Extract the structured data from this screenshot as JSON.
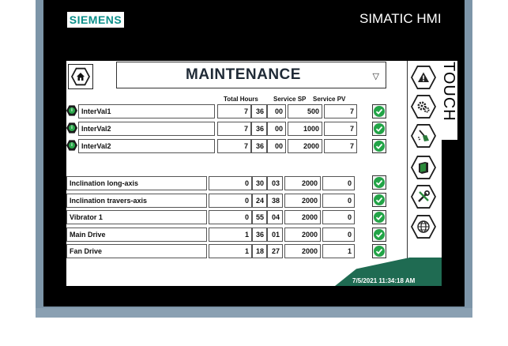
{
  "device": {
    "brand": "SIEMENS",
    "model_label": "SIMATIC HMI",
    "touch_label": "TOUCH"
  },
  "screen": {
    "title": "MAINTENANCE",
    "columns": {
      "total_hours": "Total Hours",
      "service_sp": "Service SP",
      "service_pv": "Service PV"
    },
    "intervals": [
      {
        "label": "InterVal1",
        "hours": "7",
        "minutes": "36",
        "seconds": "00",
        "service_sp": "500",
        "service_pv": "7"
      },
      {
        "label": "InterVal2",
        "hours": "7",
        "minutes": "36",
        "seconds": "00",
        "service_sp": "1000",
        "service_pv": "7"
      },
      {
        "label": "InterVal2",
        "hours": "7",
        "minutes": "36",
        "seconds": "00",
        "service_sp": "2000",
        "service_pv": "7"
      }
    ],
    "equipment": [
      {
        "label": "Inclination long-axis",
        "hours": "0",
        "minutes": "30",
        "seconds": "03",
        "service_sp": "2000",
        "service_pv": "0"
      },
      {
        "label": "Inclination travers-axis",
        "hours": "0",
        "minutes": "24",
        "seconds": "38",
        "service_sp": "2000",
        "service_pv": "0"
      },
      {
        "label": "Vibrator 1",
        "hours": "0",
        "minutes": "55",
        "seconds": "04",
        "service_sp": "2000",
        "service_pv": "0"
      },
      {
        "label": "Main Drive",
        "hours": "1",
        "minutes": "36",
        "seconds": "01",
        "service_sp": "2000",
        "service_pv": "0"
      },
      {
        "label": "Fan Drive",
        "hours": "1",
        "minutes": "18",
        "seconds": "27",
        "service_sp": "2000",
        "service_pv": "1"
      }
    ],
    "datetime": "7/5/2021 11:34:18 AM"
  },
  "nav": [
    "alarm-icon",
    "settings-gears-icon",
    "cleaning-icon",
    "manual-book-icon",
    "tools-icon",
    "network-globe-icon"
  ],
  "colors": {
    "brand": "#0b8f8a",
    "ok_green": "#22a447",
    "footer_green": "#1f6b52",
    "bezel": "#000000",
    "frame": "#7d95a8"
  }
}
